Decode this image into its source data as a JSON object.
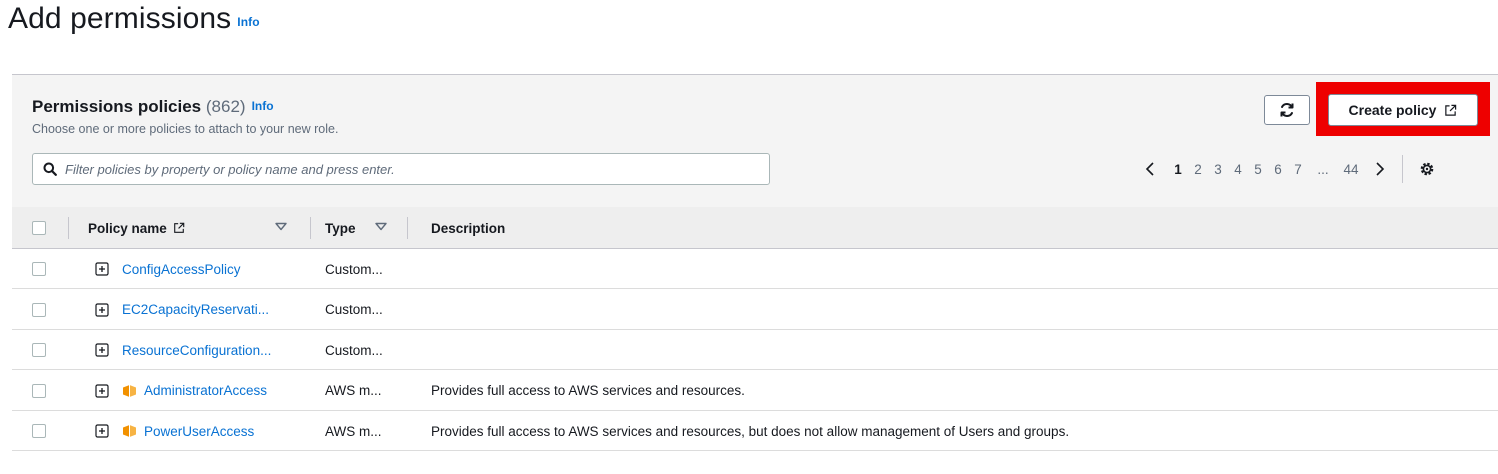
{
  "page": {
    "title": "Add permissions",
    "info": "Info"
  },
  "policies_panel": {
    "title": "Permissions policies",
    "count": "(862)",
    "info": "Info",
    "description": "Choose one or more policies to attach to your new role.",
    "create_button": "Create policy",
    "search_placeholder": "Filter policies by property or policy name and press enter."
  },
  "pagination": {
    "pages": [
      "1",
      "2",
      "3",
      "4",
      "5",
      "6",
      "7"
    ],
    "current": "1",
    "ellipsis": "...",
    "last": "44"
  },
  "table": {
    "columns": {
      "policy_name": "Policy name",
      "type": "Type",
      "description": "Description"
    },
    "rows": [
      {
        "name": "ConfigAccessPolicy",
        "type": "Custom...",
        "description": "",
        "aws_managed": false
      },
      {
        "name": "EC2CapacityReservati...",
        "type": "Custom...",
        "description": "",
        "aws_managed": false
      },
      {
        "name": "ResourceConfiguration...",
        "type": "Custom...",
        "description": "",
        "aws_managed": false
      },
      {
        "name": "AdministratorAccess",
        "type": "AWS m...",
        "description": "Provides full access to AWS services and resources.",
        "aws_managed": true
      },
      {
        "name": "PowerUserAccess",
        "type": "AWS m...",
        "description": "Provides full access to AWS services and resources, but does not allow management of Users and groups.",
        "aws_managed": true
      }
    ]
  },
  "colors": {
    "link": "#0972d3",
    "highlight": "#ee0000",
    "aws_icon": "#f29100",
    "header_bg": "#f4f4f4"
  },
  "icons": [
    "refresh-icon",
    "external-link-icon",
    "search-icon",
    "chevron-left-icon",
    "chevron-right-icon",
    "settings-icon",
    "sort-icon",
    "expand-icon",
    "aws-managed-icon"
  ]
}
